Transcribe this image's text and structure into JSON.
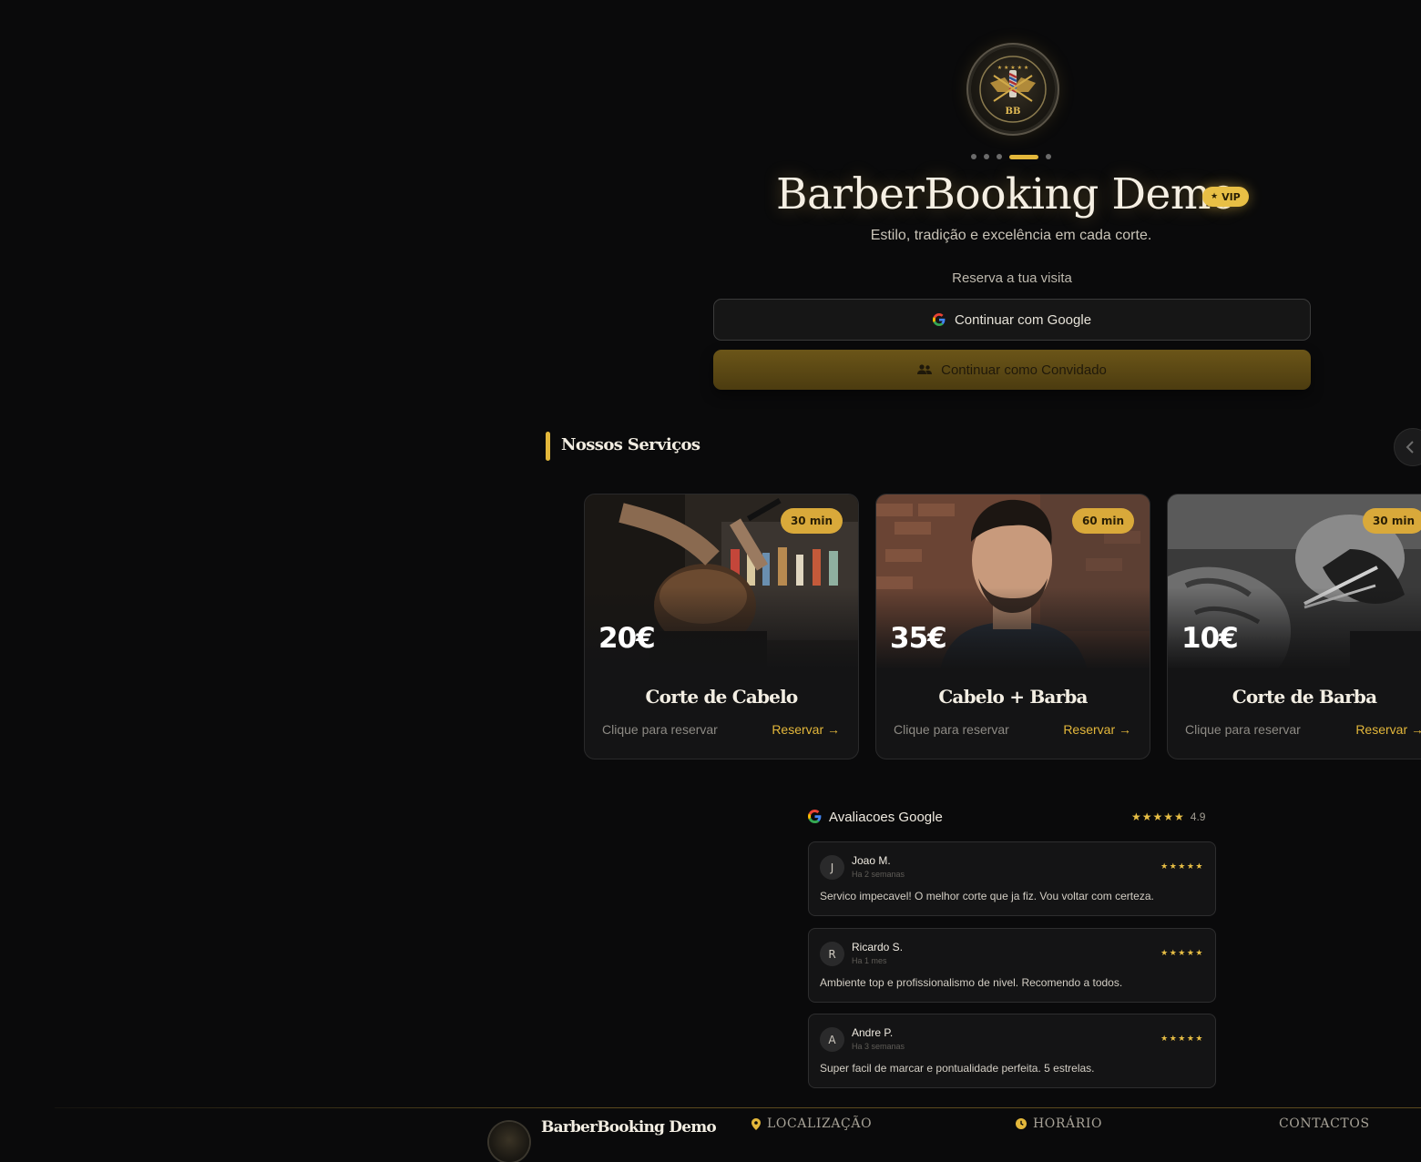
{
  "brand": {
    "logo_text": "BB",
    "title": "BarberBooking Demo",
    "badge": "VIP",
    "tagline": "Estilo, tradição e excelência em cada corte."
  },
  "auth": {
    "label": "Reserva a tua visita",
    "google_button": "Continuar com Google",
    "guest_button": "Continuar como Convidado"
  },
  "carousel": {
    "total_dots": 5,
    "active_index": 3
  },
  "services": {
    "title": "Nossos Serviços",
    "items": [
      {
        "duration": "30 min",
        "price": "20€",
        "name": "Corte de Cabelo",
        "hint": "Clique para reservar",
        "cta": "Reservar →"
      },
      {
        "duration": "60 min",
        "price": "35€",
        "name": "Cabelo + Barba",
        "hint": "Clique para reservar",
        "cta": "Reservar →"
      },
      {
        "duration": "30 min",
        "price": "10€",
        "name": "Corte de Barba",
        "hint": "Clique para reservar",
        "cta": "Reservar →"
      }
    ]
  },
  "reviews": {
    "title": "Avaliacoes Google",
    "stars": "★★★★★",
    "rating": "4.9",
    "items": [
      {
        "initial": "J",
        "name": "Joao M.",
        "date": "Ha 2 semanas",
        "stars": "★★★★★",
        "text": "Servico impecavel! O melhor corte que ja fiz. Vou voltar com certeza."
      },
      {
        "initial": "R",
        "name": "Ricardo S.",
        "date": "Ha 1 mes",
        "stars": "★★★★★",
        "text": "Ambiente top e profissionalismo de nivel. Recomendo a todos."
      },
      {
        "initial": "A",
        "name": "Andre P.",
        "date": "Ha 3 semanas",
        "stars": "★★★★★",
        "text": "Super facil de marcar e pontualidade perfeita. 5 estrelas."
      }
    ]
  },
  "footer": {
    "brand": "BarberBooking Demo",
    "location": "LOCALIZAÇÃO",
    "hours": "HORÁRIO",
    "contacts": "CONTACTOS"
  },
  "icons": {
    "google": "google-g-icon",
    "guest": "people-icon",
    "star": "star-icon",
    "location": "map-pin-icon",
    "clock": "clock-icon",
    "chevron": "chevron-left-icon"
  },
  "colors": {
    "background": "#0a0a0b",
    "accent_gold": "#e3b73b",
    "card": "#141415"
  }
}
